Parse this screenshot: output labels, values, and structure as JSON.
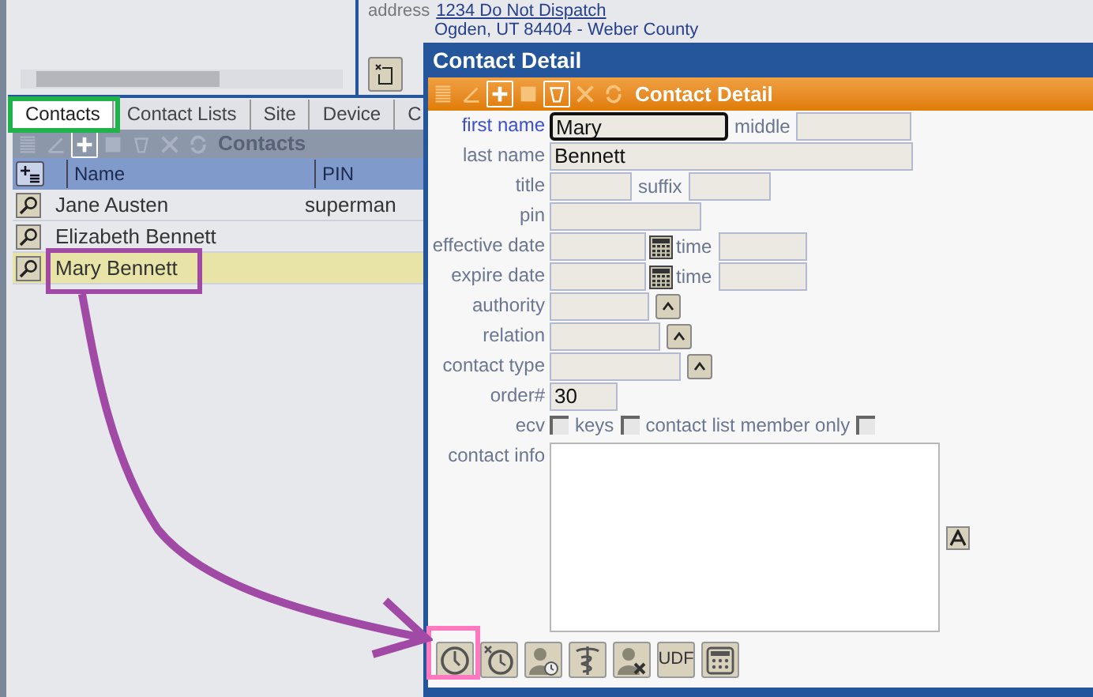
{
  "background": {
    "address_label": "address",
    "address_line_1": "1234 Do Not Dispatch",
    "address_line_2": "Ogden, UT 84404 - Weber County"
  },
  "tabs": [
    {
      "label": "Contacts",
      "selected": true
    },
    {
      "label": "Contact Lists",
      "selected": false
    },
    {
      "label": "Site",
      "selected": false
    },
    {
      "label": "Device",
      "selected": false
    },
    {
      "label": "C",
      "selected": false
    }
  ],
  "contacts_panel": {
    "title": "Contacts",
    "toolbar": [
      {
        "kind": "list",
        "disabled": true
      },
      {
        "kind": "edit",
        "disabled": true
      },
      {
        "kind": "add",
        "disabled": false
      },
      {
        "kind": "save",
        "disabled": true
      },
      {
        "kind": "delete",
        "disabled": true
      },
      {
        "kind": "cancel",
        "disabled": true
      },
      {
        "kind": "refresh",
        "disabled": true
      }
    ],
    "columns": [
      "Name",
      "PIN"
    ],
    "rows": [
      {
        "name": "Jane Austen",
        "pin": "superman",
        "selected": false
      },
      {
        "name": "Elizabeth Bennett",
        "selected": false
      },
      {
        "name": "Mary Bennett",
        "selected": true
      }
    ]
  },
  "dialog": {
    "title": "Contact Detail",
    "toolbar_title": "Contact Detail",
    "toolbar": [
      {
        "kind": "list",
        "disabled": true
      },
      {
        "kind": "edit",
        "disabled": true
      },
      {
        "kind": "add",
        "disabled": false
      },
      {
        "kind": "save",
        "disabled": true
      },
      {
        "kind": "delete",
        "disabled": false
      },
      {
        "kind": "cancel",
        "disabled": true
      },
      {
        "kind": "refresh",
        "disabled": true
      }
    ],
    "form": [
      {
        "label": "first name",
        "active": true,
        "controls": [
          {
            "kind": "input",
            "value": "Mary",
            "focused": true
          },
          {
            "kind": "label",
            "text": "middle"
          },
          {
            "kind": "input",
            "focused": false
          }
        ]
      },
      {
        "label": "last name",
        "active": false,
        "controls": [
          {
            "kind": "input",
            "value": "Bennett",
            "focused": false
          }
        ]
      },
      {
        "label": "title",
        "active": false,
        "controls": [
          {
            "kind": "input",
            "focused": false
          },
          {
            "kind": "label",
            "text": "suffix"
          },
          {
            "kind": "input",
            "focused": false
          }
        ]
      },
      {
        "label": "pin",
        "active": false,
        "controls": [
          {
            "kind": "input",
            "focused": false
          }
        ]
      },
      {
        "label": "effective date",
        "active": false,
        "controls": [
          {
            "kind": "input",
            "focused": false
          },
          {
            "kind": "calendar"
          },
          {
            "kind": "label",
            "text": "time"
          },
          {
            "kind": "input",
            "focused": false
          }
        ]
      },
      {
        "label": "expire date",
        "active": false,
        "controls": [
          {
            "kind": "input",
            "focused": false
          },
          {
            "kind": "calendar"
          },
          {
            "kind": "label",
            "text": "time"
          },
          {
            "kind": "input",
            "focused": false
          }
        ]
      },
      {
        "label": "authority",
        "active": false,
        "controls": [
          {
            "kind": "input",
            "focused": false
          },
          {
            "kind": "lookup"
          }
        ]
      },
      {
        "label": "relation",
        "active": false,
        "controls": [
          {
            "kind": "input",
            "focused": false
          },
          {
            "kind": "lookup"
          }
        ]
      },
      {
        "label": "contact type",
        "active": false,
        "controls": [
          {
            "kind": "input",
            "focused": false
          },
          {
            "kind": "lookup"
          }
        ]
      },
      {
        "label": "order#",
        "active": false,
        "controls": [
          {
            "kind": "input",
            "value": "30",
            "focused": false
          }
        ]
      },
      {
        "label": "ecv",
        "active": false,
        "controls": [
          {
            "kind": "checkbox",
            "checked": false
          },
          {
            "kind": "label",
            "text": "keys"
          },
          {
            "kind": "checkbox",
            "checked": false
          },
          {
            "kind": "label",
            "text": "contact list member only"
          },
          {
            "kind": "checkbox",
            "checked": false
          }
        ]
      },
      {
        "label": "contact info",
        "active": false,
        "controls": [
          {
            "kind": "textarea"
          },
          {
            "kind": "font"
          }
        ]
      }
    ],
    "buttons": [
      {
        "kind": "clock"
      },
      {
        "kind": "clock-x"
      },
      {
        "kind": "person-clock"
      },
      {
        "kind": "caduceus"
      },
      {
        "kind": "person-x"
      },
      {
        "kind": "text",
        "label": "UDF"
      },
      {
        "kind": "calculator"
      }
    ]
  }
}
